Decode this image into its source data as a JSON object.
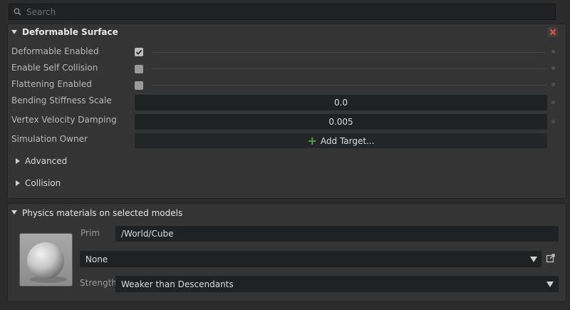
{
  "search": {
    "placeholder": "Search",
    "icon": "search-icon"
  },
  "deformable": {
    "title": "Deformable Surface",
    "rows": [
      {
        "label": "Deformable Enabled",
        "checked": true
      },
      {
        "label": "Enable Self Collision",
        "checked": false
      },
      {
        "label": "Flattening Enabled",
        "checked": false
      }
    ],
    "bending": {
      "label": "Bending Stiffness Scale",
      "value": "0.0"
    },
    "damping": {
      "label": "Vertex Velocity Damping",
      "value": "0.005"
    },
    "owner": {
      "label": "Simulation Owner",
      "button": "Add Target..."
    },
    "advanced": "Advanced",
    "collision": "Collision",
    "close_color": "#c84a4a"
  },
  "physics": {
    "title": "Physics materials on selected models",
    "prim_label": "Prim",
    "prim_value": "/World/Cube",
    "material_value": "None",
    "strength_label": "Strength",
    "strength_value": "Weaker than Descendants"
  },
  "colors": {
    "accent_plus": "#54a34a",
    "panel": "#343434",
    "field": "#1f2123"
  }
}
